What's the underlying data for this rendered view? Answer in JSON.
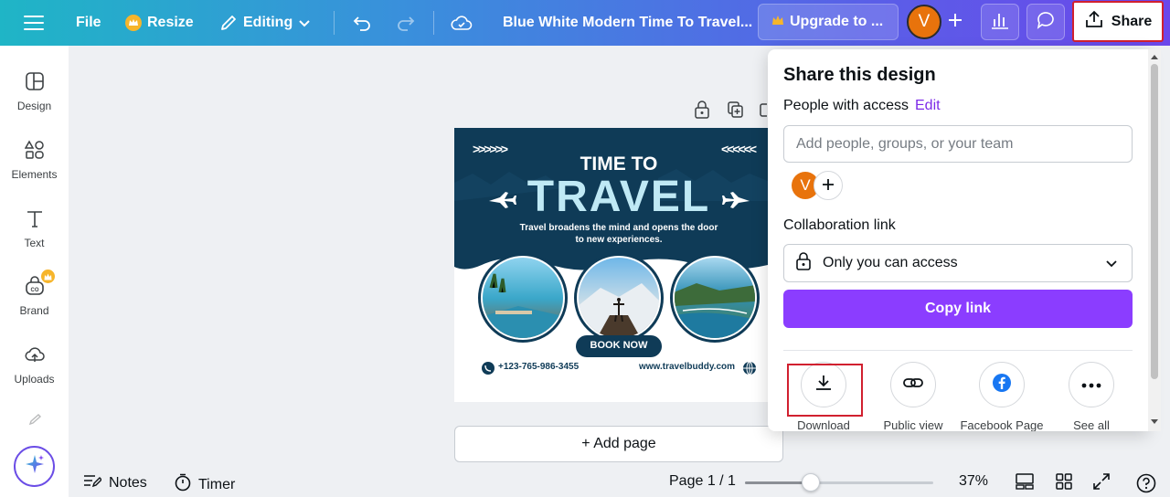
{
  "topbar": {
    "file_label": "File",
    "resize_label": "Resize",
    "editing_label": "Editing",
    "doc_title": "Blue White Modern Time To Travel...",
    "upgrade_label": "Upgrade to ...",
    "avatar_initial": "V",
    "share_label": "Share"
  },
  "sidebar": {
    "items": [
      {
        "label": "Design"
      },
      {
        "label": "Elements"
      },
      {
        "label": "Text"
      },
      {
        "label": "Brand"
      },
      {
        "label": "Uploads"
      }
    ]
  },
  "design": {
    "heading_small": "TIME TO",
    "heading_large": "TRAVEL",
    "tagline_1": "Travel broadens the mind and opens the door",
    "tagline_2": "to new experiences.",
    "book_now": "BOOK NOW",
    "phone": "+123-765-986-3455",
    "website": "www.travelbuddy.com",
    "arrows_left": ">>>>>>",
    "arrows_right": "<<<<<<"
  },
  "canvas": {
    "add_page_label": "+ Add page"
  },
  "bottombar": {
    "notes_label": "Notes",
    "timer_label": "Timer",
    "page_indicator": "Page 1 / 1",
    "zoom_level": "37%",
    "zoom_fraction": 0.35
  },
  "share_panel": {
    "title": "Share this design",
    "people_label": "People with access",
    "edit_link": "Edit",
    "add_placeholder": "Add people, groups, or your team",
    "avatar_initial": "V",
    "collab_label": "Collaboration link",
    "access_value": "Only you can access",
    "copy_link_label": "Copy link",
    "options": [
      {
        "label": "Download",
        "icon": "download-icon"
      },
      {
        "label": "Public view",
        "icon": "link-icon"
      },
      {
        "label": "Facebook Page",
        "icon": "facebook-icon"
      },
      {
        "label": "See all",
        "icon": "more-icon"
      }
    ]
  },
  "colors": {
    "accent_purple": "#8b3dff",
    "edit_purple": "#7d2ae8",
    "highlight_red": "#d1202f",
    "avatar_orange": "#e8730c",
    "design_navy": "#0f3b57"
  }
}
